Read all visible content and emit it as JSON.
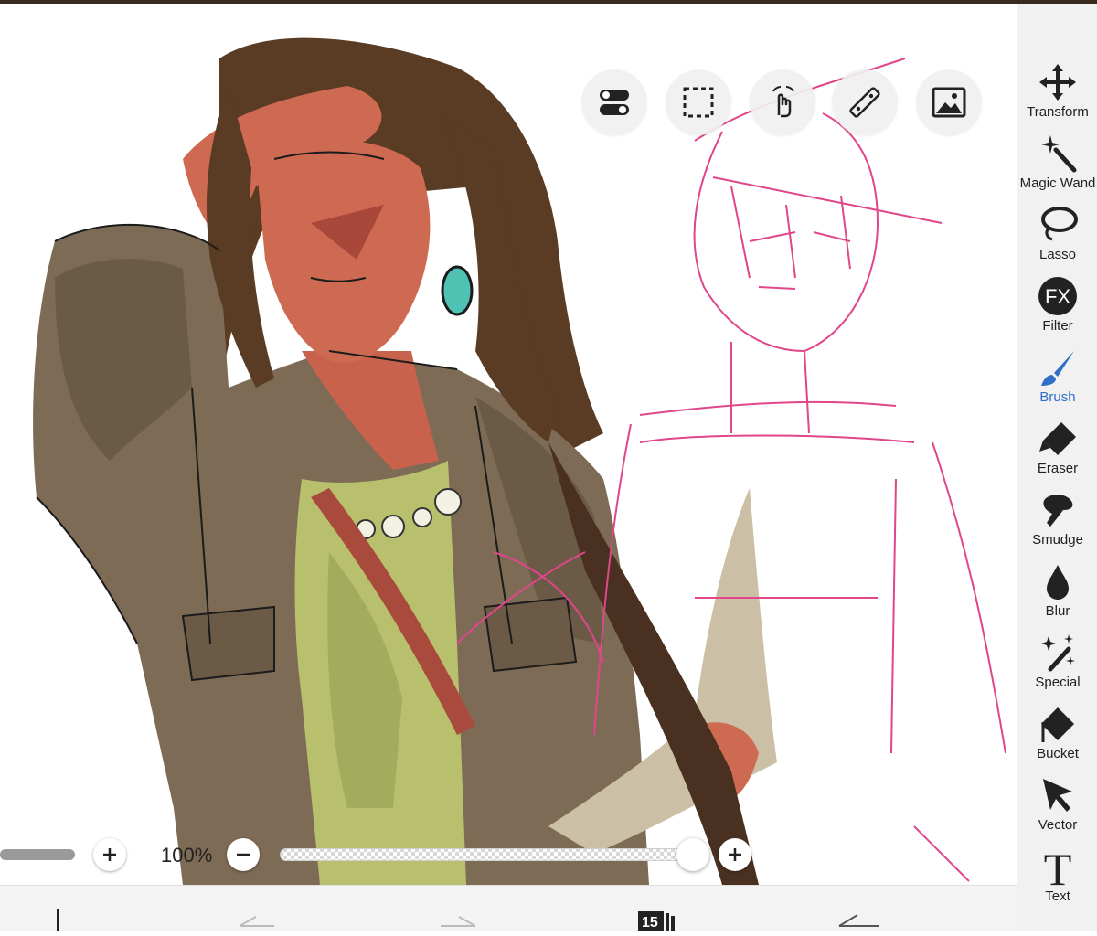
{
  "quick_tools": [
    {
      "name": "toggle-settings-icon"
    },
    {
      "name": "selection-rect-icon"
    },
    {
      "name": "hand-touch-icon"
    },
    {
      "name": "ruler-icon"
    },
    {
      "name": "image-reference-icon"
    }
  ],
  "tools": [
    {
      "label": "Transform",
      "icon": "move-arrows-icon",
      "active": false
    },
    {
      "label": "Magic Wand",
      "icon": "magic-wand-icon",
      "active": false
    },
    {
      "label": "Lasso",
      "icon": "lasso-icon",
      "active": false
    },
    {
      "label": "Filter",
      "icon": "fx-filter-icon",
      "active": false
    },
    {
      "label": "Brush",
      "icon": "brush-icon",
      "active": true
    },
    {
      "label": "Eraser",
      "icon": "eraser-icon",
      "active": false
    },
    {
      "label": "Smudge",
      "icon": "smudge-icon",
      "active": false
    },
    {
      "label": "Blur",
      "icon": "blur-drop-icon",
      "active": false
    },
    {
      "label": "Special",
      "icon": "special-sparkle-icon",
      "active": false
    },
    {
      "label": "Bucket",
      "icon": "bucket-icon",
      "active": false
    },
    {
      "label": "Vector",
      "icon": "vector-cursor-icon",
      "active": false
    },
    {
      "label": "Text",
      "icon": "text-t-icon",
      "active": false
    }
  ],
  "zoom": {
    "label": "100%",
    "opacity_slider_level": 0.98
  },
  "bottom_bar": {
    "layer_count": "15"
  },
  "colors": {
    "accent": "#2f6fc8",
    "sketch_line": "#e0468a",
    "toolbar_bg": "#f1f1f1"
  }
}
